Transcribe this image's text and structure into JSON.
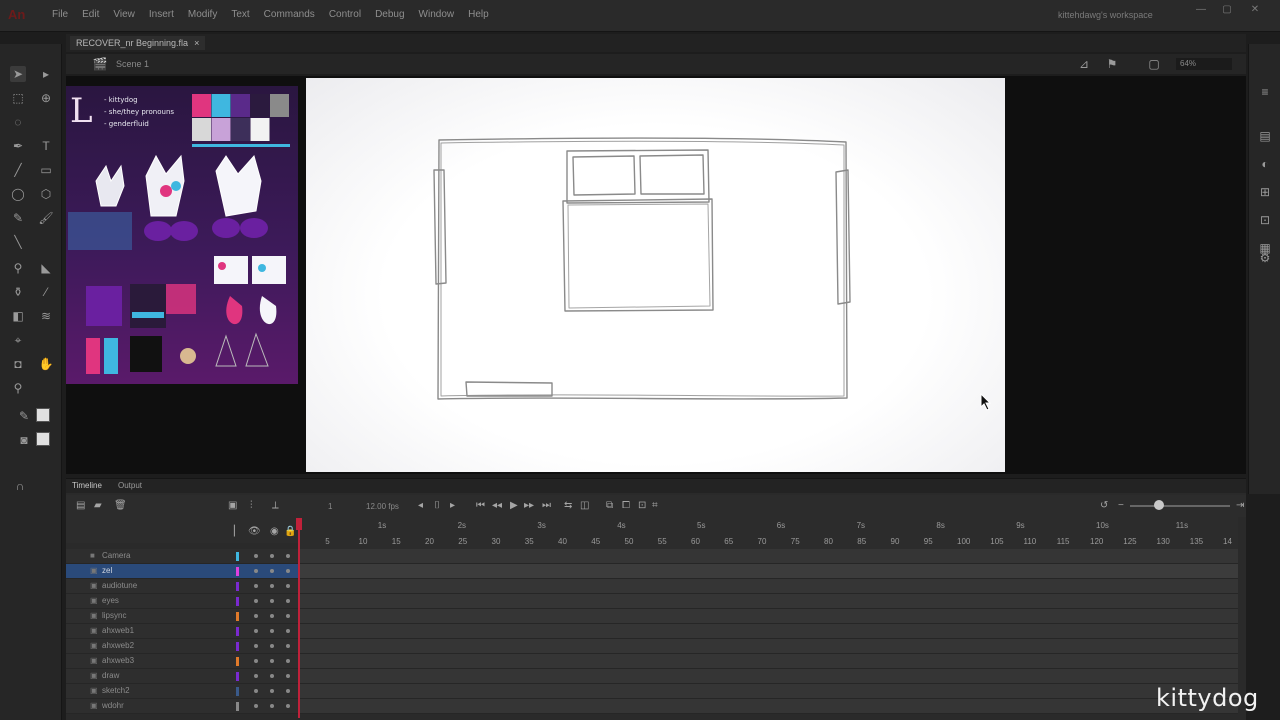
{
  "app": {
    "menu": [
      "File",
      "Edit",
      "View",
      "Insert",
      "Modify",
      "Text",
      "Commands",
      "Control",
      "Debug",
      "Window",
      "Help"
    ],
    "workspace": "kittehdawg's workspace",
    "logo_text": "An"
  },
  "document": {
    "tab_name": "RECOVER_nr Beginning.fla",
    "tab_close": "×",
    "scene": "Scene 1",
    "zoom": "64%"
  },
  "reference_panel": {
    "notes": [
      "- kittydog",
      "- she/they pronouns",
      "- genderfluid"
    ],
    "palette": [
      "#e0357f",
      "#3fb7e0",
      "#5a2a8a",
      "#2b1a3e",
      "#8a8a8a",
      "#d8d8d8",
      "#c8a2d8",
      "#3d2f5a",
      "#f2f2f2"
    ]
  },
  "timeline": {
    "tabs": [
      "Timeline",
      "Output"
    ],
    "fps": "12.00 fps",
    "current_frame": "1",
    "seconds": [
      "1s",
      "2s",
      "3s",
      "4s",
      "5s",
      "6s",
      "7s",
      "8s",
      "9s",
      "10s",
      "11s"
    ],
    "frame_numbers": [
      "5",
      "10",
      "15",
      "20",
      "25",
      "30",
      "35",
      "40",
      "45",
      "50",
      "55",
      "60",
      "65",
      "70",
      "75",
      "80",
      "85",
      "90",
      "95",
      "100",
      "105",
      "110",
      "115",
      "120",
      "125",
      "130",
      "135",
      "14"
    ],
    "layers": [
      {
        "name": "Camera",
        "color": "#3fb7e0"
      },
      {
        "name": "zel",
        "color": "#e040e0"
      },
      {
        "name": "audiotune",
        "color": "#7a2ad0"
      },
      {
        "name": "eyes",
        "color": "#7a2ad0"
      },
      {
        "name": "lipsync",
        "color": "#e07a2a"
      },
      {
        "name": "ahxweb1",
        "color": "#7a2ad0"
      },
      {
        "name": "ahxweb2",
        "color": "#7a2ad0"
      },
      {
        "name": "ahxweb3",
        "color": "#e07a2a"
      },
      {
        "name": "draw",
        "color": "#7a2ad0"
      },
      {
        "name": "sketch2",
        "color": "#3a5a8a"
      },
      {
        "name": "wdohr",
        "color": "#888888"
      }
    ]
  },
  "watermark": "kittydog"
}
